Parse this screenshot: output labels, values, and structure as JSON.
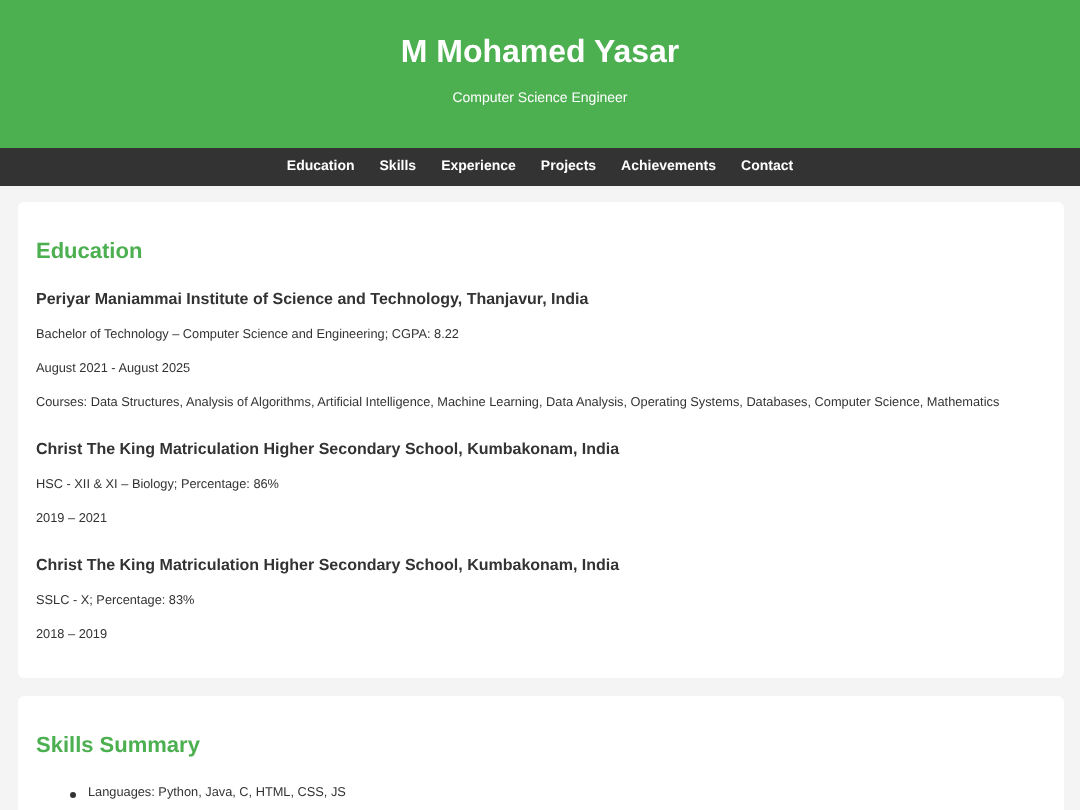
{
  "header": {
    "name": "M Mohamed Yasar",
    "subtitle": "Computer Science Engineer"
  },
  "nav": [
    {
      "label": "Education"
    },
    {
      "label": "Skills"
    },
    {
      "label": "Experience"
    },
    {
      "label": "Projects"
    },
    {
      "label": "Achievements"
    },
    {
      "label": "Contact"
    }
  ],
  "education": {
    "heading": "Education",
    "entries": [
      {
        "school": "Periyar Maniammai Institute of Science and Technology, Thanjavur, India",
        "lines": [
          "Bachelor of Technology – Computer Science and Engineering; CGPA: 8.22",
          "August 2021 - August 2025",
          "Courses: Data Structures, Analysis of Algorithms, Artificial Intelligence, Machine Learning, Data Analysis, Operating Systems, Databases, Computer Science, Mathematics"
        ]
      },
      {
        "school": "Christ The King Matriculation Higher Secondary School, Kumbakonam, India",
        "lines": [
          "HSC - XII & XI – Biology; Percentage: 86%",
          "2019 – 2021"
        ]
      },
      {
        "school": "Christ The King Matriculation Higher Secondary School, Kumbakonam, India",
        "lines": [
          "SSLC - X; Percentage: 83%",
          "2018 – 2019"
        ]
      }
    ]
  },
  "skills": {
    "heading": "Skills Summary",
    "items": [
      "Languages: Python, Java, C, HTML, CSS, JS"
    ]
  }
}
